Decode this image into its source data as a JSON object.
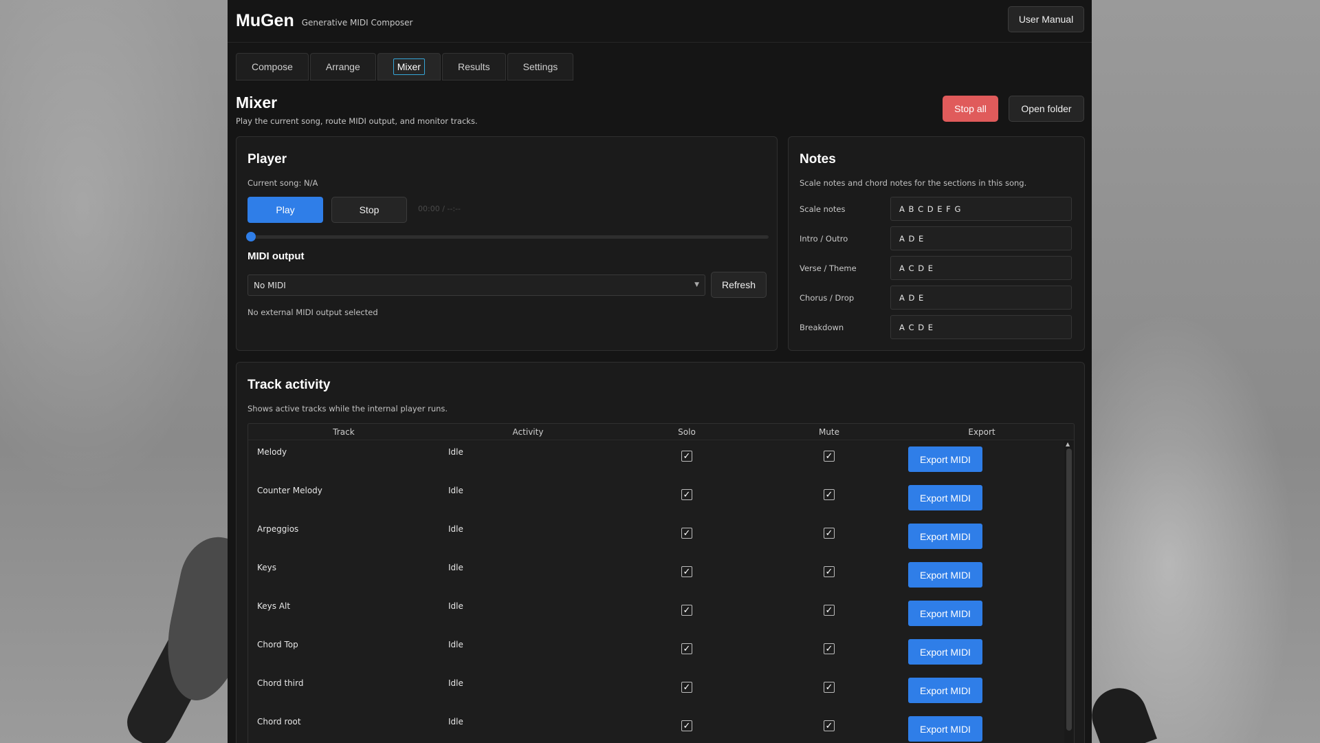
{
  "app": {
    "name": "MuGen",
    "subtitle": "Generative MIDI Composer",
    "manual_label": "User Manual"
  },
  "tabs": [
    {
      "label": "Compose",
      "active": false
    },
    {
      "label": "Arrange",
      "active": false
    },
    {
      "label": "Mixer",
      "active": true
    },
    {
      "label": "Results",
      "active": false
    },
    {
      "label": "Settings",
      "active": false
    }
  ],
  "page": {
    "title": "Mixer",
    "subtitle": "Play the current song, route MIDI output, and monitor tracks.",
    "stop_all_label": "Stop all",
    "open_folder_label": "Open folder"
  },
  "player": {
    "title": "Player",
    "current_song": "Current song: N/A",
    "play_label": "Play",
    "stop_label": "Stop",
    "time": "00:00 / --:--",
    "progress": 0.0,
    "midi_title": "MIDI output",
    "midi_selected": "No MIDI",
    "refresh_label": "Refresh",
    "midi_status": "No external MIDI output selected"
  },
  "notes": {
    "title": "Notes",
    "description": "Scale notes and chord notes for the sections in this song.",
    "rows": [
      {
        "label": "Scale notes",
        "value": "A B C D E F G"
      },
      {
        "label": "Intro / Outro",
        "value": "A D E"
      },
      {
        "label": "Verse / Theme",
        "value": "A C D E"
      },
      {
        "label": "Chorus / Drop",
        "value": "A D E"
      },
      {
        "label": "Breakdown",
        "value": "A C D E"
      }
    ]
  },
  "tracks": {
    "title": "Track activity",
    "description": "Shows active tracks while the internal player runs.",
    "columns": [
      "Track",
      "Activity",
      "Solo",
      "Mute",
      "Export"
    ],
    "export_label": "Export MIDI",
    "rows": [
      {
        "name": "Melody",
        "activity": "Idle",
        "solo": true,
        "mute": true
      },
      {
        "name": "Counter Melody",
        "activity": "Idle",
        "solo": true,
        "mute": true
      },
      {
        "name": "Arpeggios",
        "activity": "Idle",
        "solo": true,
        "mute": true
      },
      {
        "name": "Keys",
        "activity": "Idle",
        "solo": true,
        "mute": true
      },
      {
        "name": "Keys Alt",
        "activity": "Idle",
        "solo": true,
        "mute": true
      },
      {
        "name": "Chord Top",
        "activity": "Idle",
        "solo": true,
        "mute": true
      },
      {
        "name": "Chord third",
        "activity": "Idle",
        "solo": true,
        "mute": true
      },
      {
        "name": "Chord root",
        "activity": "Idle",
        "solo": true,
        "mute": true
      }
    ]
  },
  "colors": {
    "accent": "#2f7ee8",
    "danger": "#e05b5b",
    "panel": "#1b1b1b",
    "background": "#151515"
  },
  "icons": {
    "dropdown": "chevron-down-icon",
    "checkbox": "checkmark-icon",
    "scroll": "scroll-up-arrow-icon"
  }
}
